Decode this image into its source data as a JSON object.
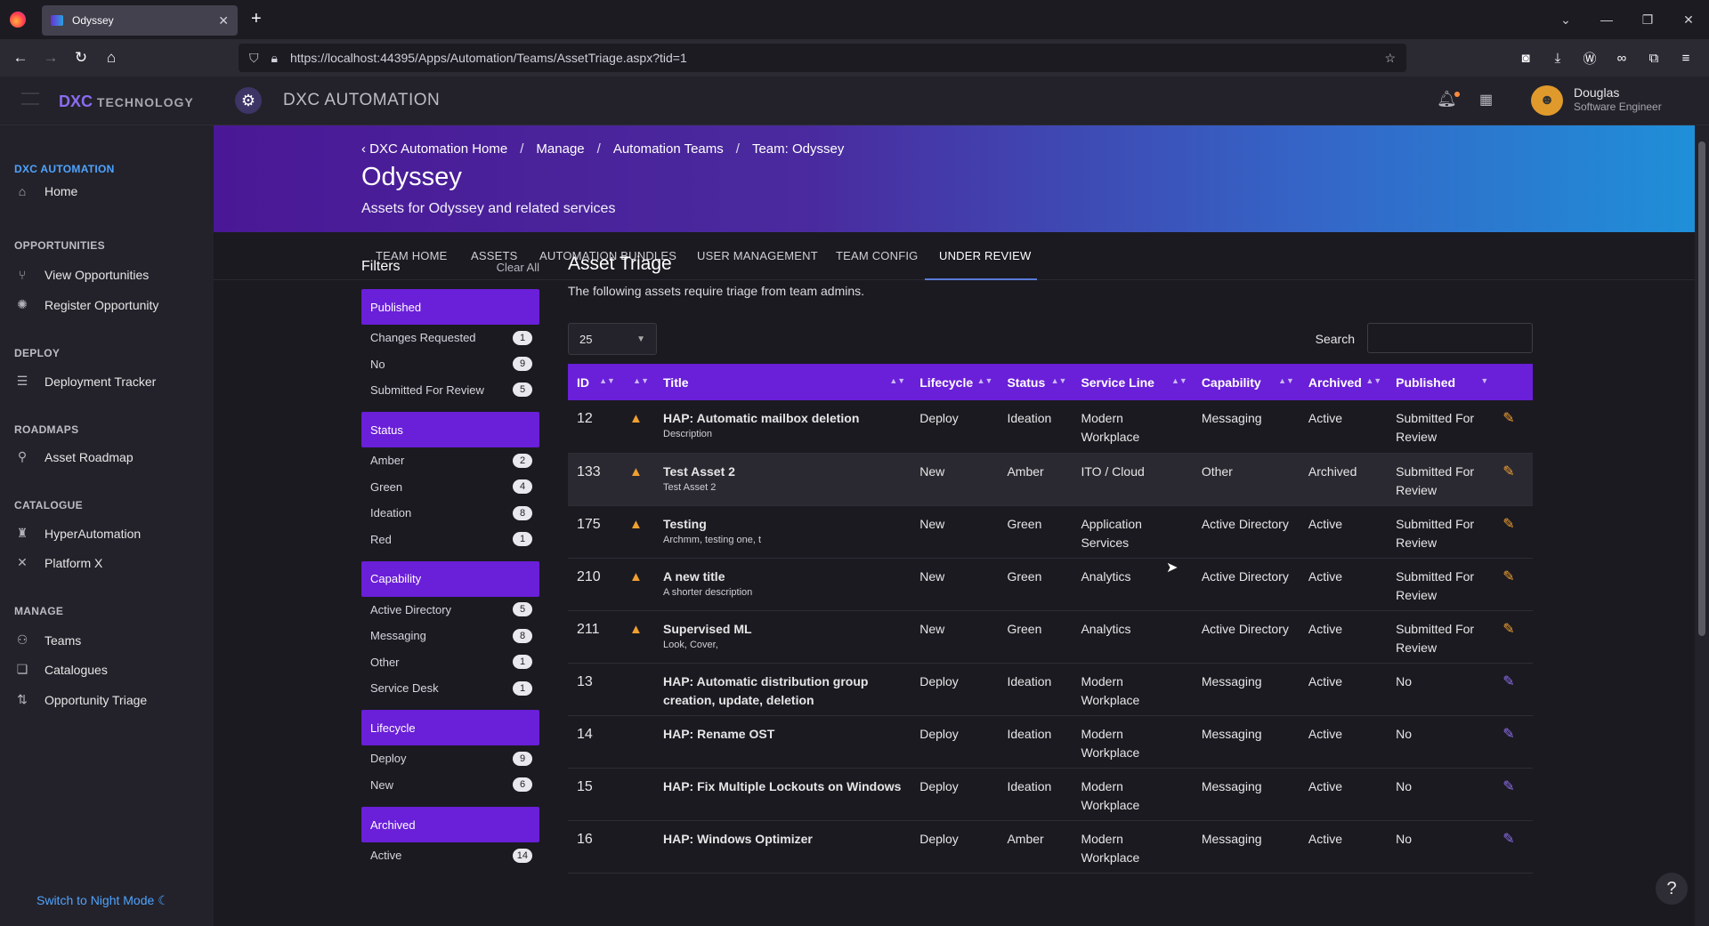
{
  "browser": {
    "tab_title": "Odyssey",
    "url": "https://localhost:44395/Apps/Automation/Teams/AssetTriage.aspx?tid=1"
  },
  "header": {
    "brand": "DXC",
    "brand_suffix": "TECHNOLOGY",
    "app_title": "DXC AUTOMATION",
    "user_name": "Douglas",
    "user_role": "Software Engineer"
  },
  "sidebar": {
    "sections": [
      {
        "title": "DXC AUTOMATION",
        "items": [
          {
            "label": "Home",
            "icon": "home-icon"
          }
        ]
      },
      {
        "title": "OPPORTUNITIES",
        "items": [
          {
            "label": "View Opportunities",
            "icon": "branch-icon"
          },
          {
            "label": "Register Opportunity",
            "icon": "bulb-icon"
          }
        ]
      },
      {
        "title": "DEPLOY",
        "items": [
          {
            "label": "Deployment Tracker",
            "icon": "tracker-icon"
          }
        ]
      },
      {
        "title": "ROADMAPS",
        "items": [
          {
            "label": "Asset Roadmap",
            "icon": "map-pin-icon"
          }
        ]
      },
      {
        "title": "CATALOGUE",
        "items": [
          {
            "label": "HyperAutomation",
            "icon": "robot-icon"
          },
          {
            "label": "Platform X",
            "icon": "x-icon"
          }
        ]
      },
      {
        "title": "MANAGE",
        "items": [
          {
            "label": "Teams",
            "icon": "teams-icon"
          },
          {
            "label": "Catalogues",
            "icon": "catalogue-icon"
          },
          {
            "label": "Opportunity Triage",
            "icon": "triage-icon"
          }
        ]
      }
    ],
    "night_mode": "Switch to Night Mode"
  },
  "banner": {
    "breadcrumb": [
      "DXC Automation Home",
      "Manage",
      "Automation Teams",
      "Team: Odyssey"
    ],
    "title": "Odyssey",
    "subtitle": "Assets for Odyssey and related services"
  },
  "tabs": [
    "TEAM HOME",
    "ASSETS",
    "AUTOMATION BUNDLES",
    "USER MANAGEMENT",
    "TEAM CONFIG",
    "UNDER REVIEW"
  ],
  "active_tab": "UNDER REVIEW",
  "filters": {
    "title": "Filters",
    "clear": "Clear All",
    "groups": [
      {
        "name": "Published",
        "rows": [
          [
            "Changes Requested",
            "1"
          ],
          [
            "No",
            "9"
          ],
          [
            "Submitted For Review",
            "5"
          ]
        ]
      },
      {
        "name": "Status",
        "rows": [
          [
            "Amber",
            "2"
          ],
          [
            "Green",
            "4"
          ],
          [
            "Ideation",
            "8"
          ],
          [
            "Red",
            "1"
          ]
        ]
      },
      {
        "name": "Capability",
        "rows": [
          [
            "Active Directory",
            "5"
          ],
          [
            "Messaging",
            "8"
          ],
          [
            "Other",
            "1"
          ],
          [
            "Service Desk",
            "1"
          ]
        ]
      },
      {
        "name": "Lifecycle",
        "rows": [
          [
            "Deploy",
            "9"
          ],
          [
            "New",
            "6"
          ]
        ]
      },
      {
        "name": "Archived",
        "rows": [
          [
            "Active",
            "14"
          ]
        ]
      }
    ]
  },
  "content": {
    "title": "Asset Triage",
    "description": "The following assets require triage from team admins.",
    "page_size": "25",
    "search_label": "Search",
    "columns": [
      "ID",
      "",
      "Title",
      "Lifecycle",
      "Status",
      "Service Line",
      "Capability",
      "Archived",
      "Published",
      ""
    ],
    "rows": [
      {
        "id": "12",
        "warn": true,
        "title": "HAP: Automatic mailbox deletion",
        "desc": "Description",
        "lifecycle": "Deploy",
        "status": "Ideation",
        "service": "Modern Workplace",
        "capability": "Messaging",
        "archived": "Active",
        "published": "Submitted For Review",
        "edit_color": "orange"
      },
      {
        "id": "133",
        "warn": true,
        "title": "Test Asset 2",
        "desc": "Test Asset 2",
        "lifecycle": "New",
        "status": "Amber",
        "service": "ITO / Cloud",
        "capability": "Other",
        "archived": "Archived",
        "published": "Submitted For Review",
        "edit_color": "orange"
      },
      {
        "id": "175",
        "warn": true,
        "title": "Testing",
        "desc": "Archmm, testing one, t",
        "lifecycle": "New",
        "status": "Green",
        "service": "Application Services",
        "capability": "Active Directory",
        "archived": "Active",
        "published": "Submitted For Review",
        "edit_color": "orange"
      },
      {
        "id": "210",
        "warn": true,
        "title": "A new title",
        "desc": "A shorter description",
        "lifecycle": "New",
        "status": "Green",
        "service": "Analytics",
        "capability": "Active Directory",
        "archived": "Active",
        "published": "Submitted For Review",
        "edit_color": "orange"
      },
      {
        "id": "211",
        "warn": true,
        "title": "Supervised ML",
        "desc": "Look, Cover,",
        "lifecycle": "New",
        "status": "Green",
        "service": "Analytics",
        "capability": "Active Directory",
        "archived": "Active",
        "published": "Submitted For Review",
        "edit_color": "orange"
      },
      {
        "id": "13",
        "warn": false,
        "title": "HAP: Automatic distribution group creation, update, deletion",
        "desc": "",
        "lifecycle": "Deploy",
        "status": "Ideation",
        "service": "Modern Workplace",
        "capability": "Messaging",
        "archived": "Active",
        "published": "No",
        "edit_color": "purple"
      },
      {
        "id": "14",
        "warn": false,
        "title": "HAP: Rename OST",
        "desc": "",
        "lifecycle": "Deploy",
        "status": "Ideation",
        "service": "Modern Workplace",
        "capability": "Messaging",
        "archived": "Active",
        "published": "No",
        "edit_color": "purple"
      },
      {
        "id": "15",
        "warn": false,
        "title": "HAP: Fix Multiple Lockouts on Windows",
        "desc": "",
        "lifecycle": "Deploy",
        "status": "Ideation",
        "service": "Modern Workplace",
        "capability": "Messaging",
        "archived": "Active",
        "published": "No",
        "edit_color": "purple"
      },
      {
        "id": "16",
        "warn": false,
        "title": "HAP: Windows Optimizer",
        "desc": "",
        "lifecycle": "Deploy",
        "status": "Amber",
        "service": "Modern Workplace",
        "capability": "Messaging",
        "archived": "Active",
        "published": "No",
        "edit_color": "purple"
      }
    ]
  },
  "colors": {
    "accent": "#6a1fd8",
    "warning": "#f0a030",
    "link": "#4fa3ff"
  }
}
